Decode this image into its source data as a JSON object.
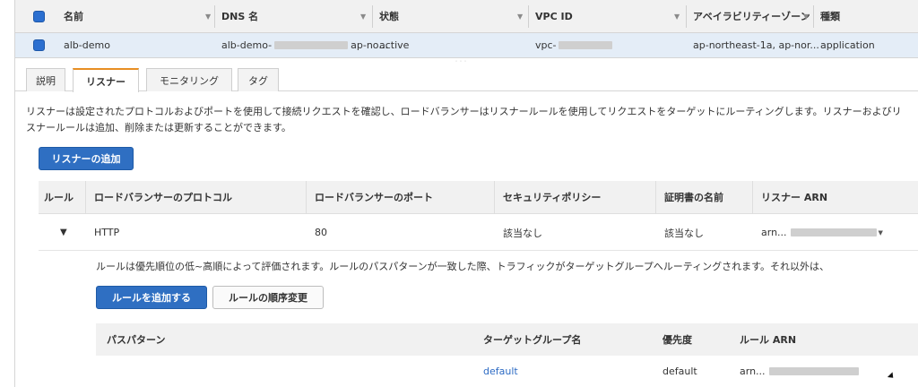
{
  "load_balancers": {
    "columns": [
      "名前",
      "DNS 名",
      "状態",
      "VPC ID",
      "アベイラビリティーゾーン",
      "種類"
    ],
    "row": {
      "name": "alb-demo",
      "dns_prefix": "alb-demo-",
      "dns_suffix": "ap-no...",
      "state": "active",
      "vpc_prefix": "vpc-",
      "availability_zones": "ap-northeast-1a, ap-nor...",
      "type": "application"
    }
  },
  "resize_handle": "˙˙˙",
  "tabs": [
    {
      "label": "説明",
      "active": false
    },
    {
      "label": "リスナー",
      "active": true
    },
    {
      "label": "モニタリング",
      "active": false
    },
    {
      "label": "タグ",
      "active": false
    }
  ],
  "listener_description": "リスナーは設定されたプロトコルおよびポートを使用して接続リクエストを確認し、ロードバランサーはリスナールールを使用してリクエストをターゲットにルーティングします。リスナーおよびリスナールールは追加、削除または更新することができます。",
  "add_listener_label": "リスナーの追加",
  "listeners": {
    "columns": [
      "ルール",
      "ロードバランサーのプロトコル",
      "ロードバランサーのポート",
      "セキュリティポリシー",
      "証明書の名前",
      "リスナー ARN"
    ],
    "row": {
      "protocol": "HTTP",
      "port": "80",
      "security_policy": "該当なし",
      "certificate": "該当なし",
      "arn_prefix": "arn..."
    }
  },
  "rules_description": "ルールは優先順位の低~高順によって評価されます。ルールのパスパターンが一致した際、トラフィックがターゲットグループへルーティングされます。それ以外は、",
  "add_rule_label": "ルールを追加する",
  "reorder_rules_label": "ルールの順序変更",
  "rules": {
    "columns": [
      "パスパターン",
      "ターゲットグループ名",
      "優先度",
      "ルール ARN"
    ],
    "row": {
      "path_pattern": "",
      "target_group": "default",
      "priority": "default",
      "arn_prefix": "arn..."
    }
  },
  "colors": {
    "primary": "#2f6fc2",
    "selected_row": "#e4edf7",
    "active_tab_accent": "#e88e23",
    "link": "#2d6bc4"
  }
}
